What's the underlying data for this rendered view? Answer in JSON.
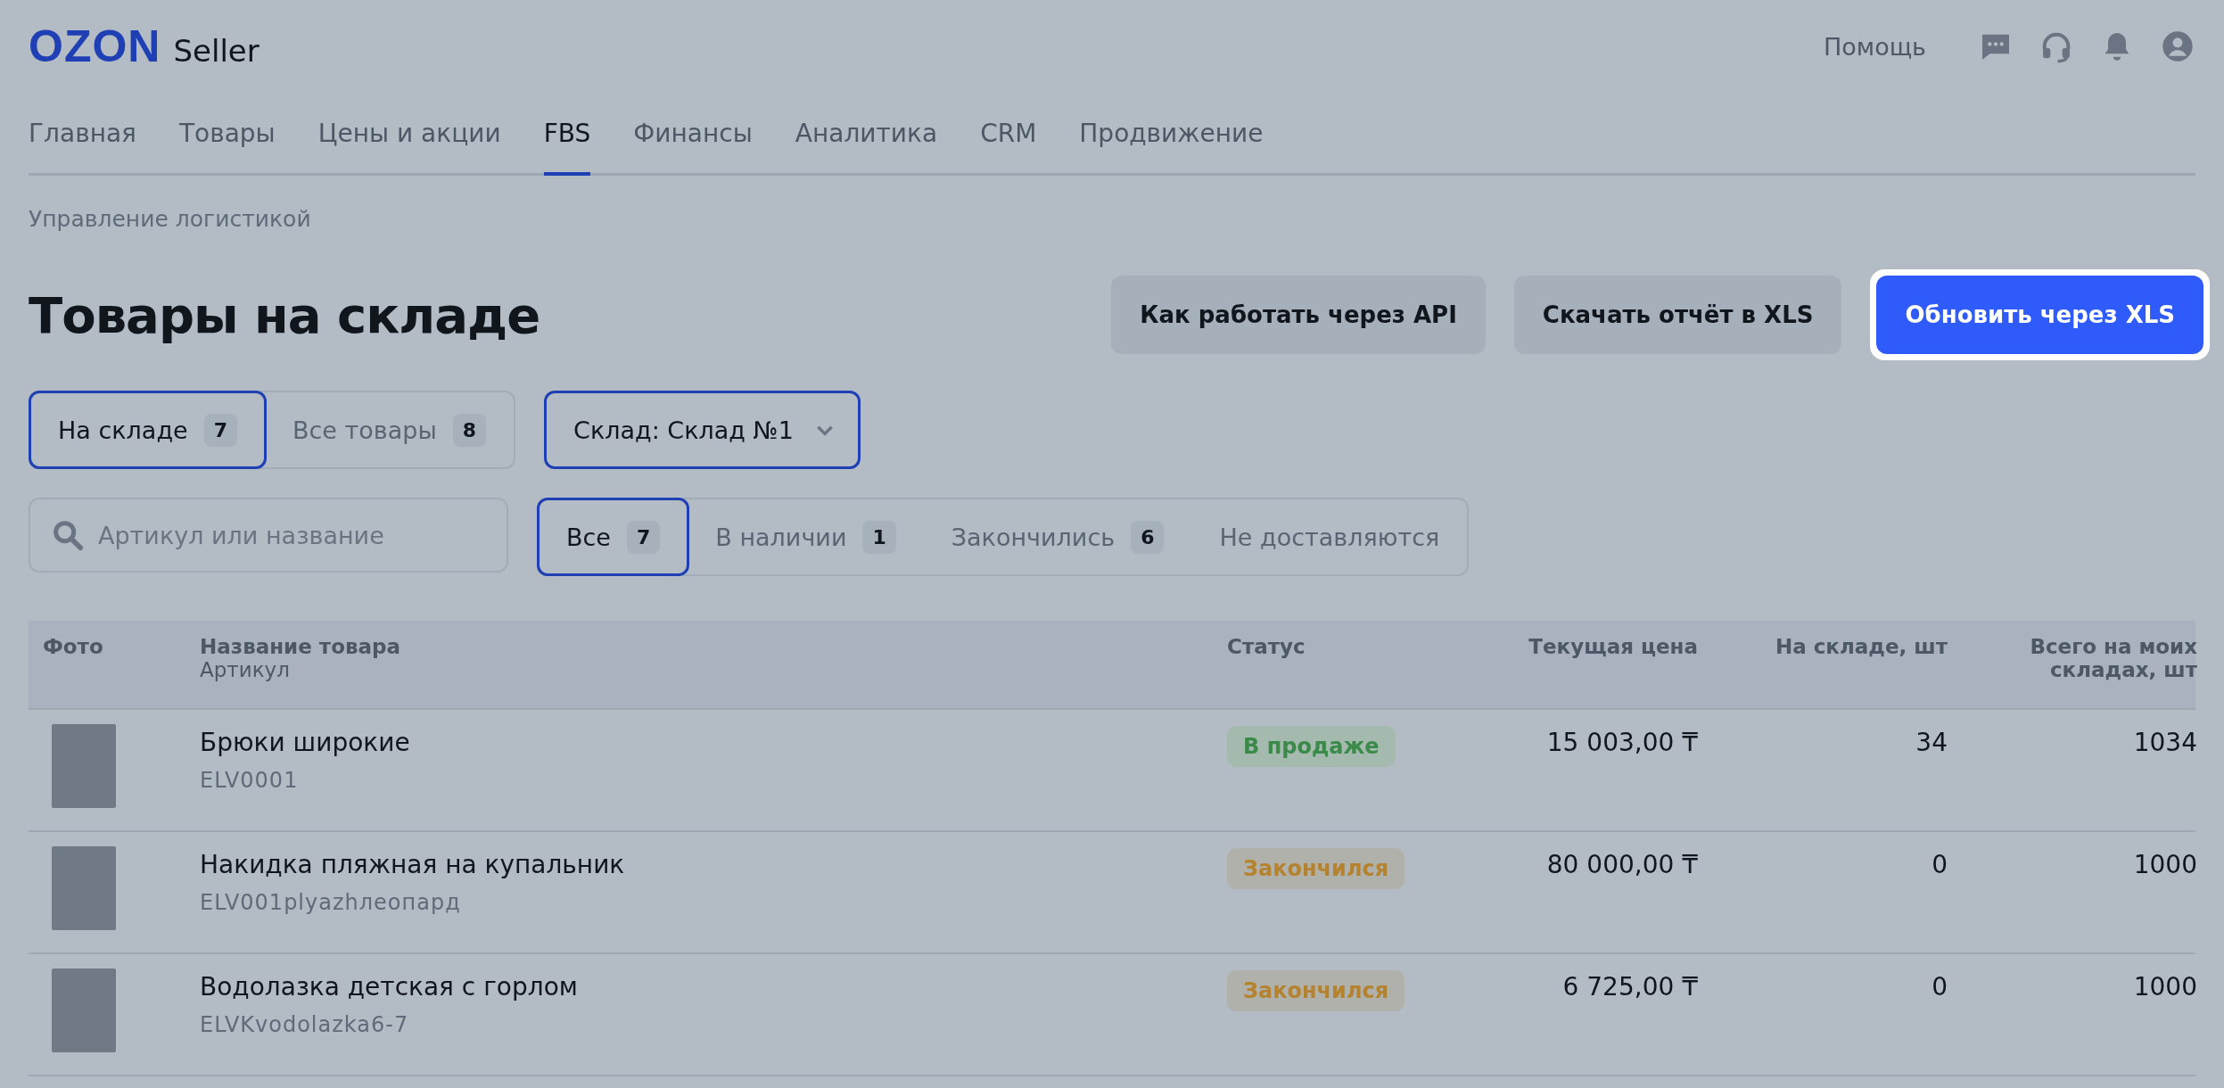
{
  "header": {
    "logo": {
      "brand": "OZON",
      "product": "Seller"
    },
    "help": "Помощь"
  },
  "nav": [
    {
      "label": "Главная",
      "selected": false
    },
    {
      "label": "Товары",
      "selected": false
    },
    {
      "label": "Цены и акции",
      "selected": false
    },
    {
      "label": "FBS",
      "selected": true
    },
    {
      "label": "Финансы",
      "selected": false
    },
    {
      "label": "Аналитика",
      "selected": false
    },
    {
      "label": "CRM",
      "selected": false
    },
    {
      "label": "Продвижение",
      "selected": false
    }
  ],
  "breadcrumb": "Управление логистикой",
  "title": "Товары на складе",
  "actions": [
    {
      "label": "Как работать через API",
      "kind": "secondary"
    },
    {
      "label": "Скачать отчёт в XLS",
      "kind": "secondary"
    },
    {
      "label": "Обновить через XLS",
      "kind": "primary"
    }
  ],
  "stock_tabs": [
    {
      "label": "На складе",
      "count": "7",
      "selected": true
    },
    {
      "label": "Все товары",
      "count": "8",
      "selected": false
    }
  ],
  "warehouse_select": {
    "label": "Склад: Склад №1"
  },
  "search": {
    "placeholder": "Артикул или название"
  },
  "status_filters": [
    {
      "label": "Все",
      "count": "7",
      "selected": true
    },
    {
      "label": "В наличии",
      "count": "1",
      "selected": false
    },
    {
      "label": "Закончились",
      "count": "6",
      "selected": false
    },
    {
      "label": "Не доставляются",
      "selected": false
    }
  ],
  "table": {
    "columns": [
      {
        "title": "Фото"
      },
      {
        "title": "Название товара",
        "subtitle": "Артикул"
      },
      {
        "title": "Статус"
      },
      {
        "title": "Текущая цена"
      },
      {
        "title": "На складе, шт"
      },
      {
        "title": "Всего на моих складах, шт"
      }
    ],
    "rows": [
      {
        "name": "Брюки широкие",
        "sku": "ELV0001",
        "status": {
          "label": "В продаже",
          "kind": "on_sale"
        },
        "price": "15 003,00 ₸",
        "in_stock": "34",
        "total": "1034"
      },
      {
        "name": "Накидка пляжная на купальник",
        "sku": "ELV001plyazhлеопард",
        "status": {
          "label": "Закончился",
          "kind": "out"
        },
        "price": "80 000,00 ₸",
        "in_stock": "0",
        "total": "1000"
      },
      {
        "name": "Водолазка детская с горлом",
        "sku": "ELVKvodolazka6-7",
        "status": {
          "label": "Закончился",
          "kind": "out"
        },
        "price": "6 725,00 ₸",
        "in_stock": "0",
        "total": "1000"
      }
    ]
  }
}
